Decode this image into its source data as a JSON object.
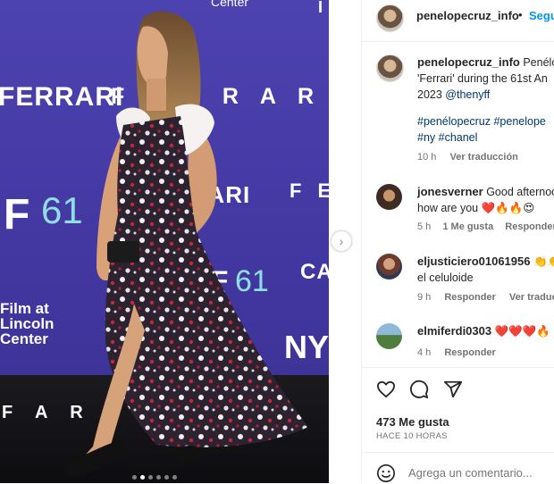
{
  "post": {
    "author": "penelopecruz_info",
    "follow_label": "Segu",
    "dot": "•",
    "caption_line1": "Penélo",
    "caption_line2": "'Ferrari' during the 61st An",
    "caption_line3_prefix": "2023 ",
    "caption_mention": "@thenyff",
    "hashtags_line1": "#penélopecruz #penelope",
    "hashtags_line2": "#ny #chanel",
    "time": "10 h",
    "see_translation": "Ver traducción"
  },
  "photo_backdrop": {
    "words": [
      "FERRARI",
      "F E R R A R I",
      "F 61",
      "FERRARI",
      "F E",
      "F 61",
      "CA",
      "NY",
      "F A R I"
    ],
    "film_at_lincoln_center": [
      "Film at",
      "Lincoln",
      "Center"
    ],
    "center": "Center"
  },
  "carousel": {
    "slides": 6,
    "active": 1
  },
  "comments": [
    {
      "user": "jonesverner",
      "text_line1": "Good afternoo",
      "text_line2": "how are you",
      "emoji": "❤️🔥🔥😍",
      "time": "5 h",
      "likes": "1 Me gusta",
      "reply": "Responder"
    },
    {
      "user": "eljusticiero01061956",
      "emoji_inline": "👏👏",
      "text_line2": "el celuloide",
      "time": "9 h",
      "reply": "Responder",
      "translate": "Ver traducci"
    },
    {
      "user": "elmiferdi0303",
      "emoji_inline": "❤️❤️❤️🔥",
      "time": "4 h",
      "reply": "Responder"
    }
  ],
  "actions": {
    "likes": "473 Me gusta",
    "posted_ago": "HACE 10 HORAS",
    "comment_placeholder": "Agrega un comentario..."
  },
  "colors": {
    "backdrop": "#4639a8",
    "follow_blue": "#0095f6",
    "hashtag_blue": "#00376b",
    "muted_text": "#737373"
  }
}
